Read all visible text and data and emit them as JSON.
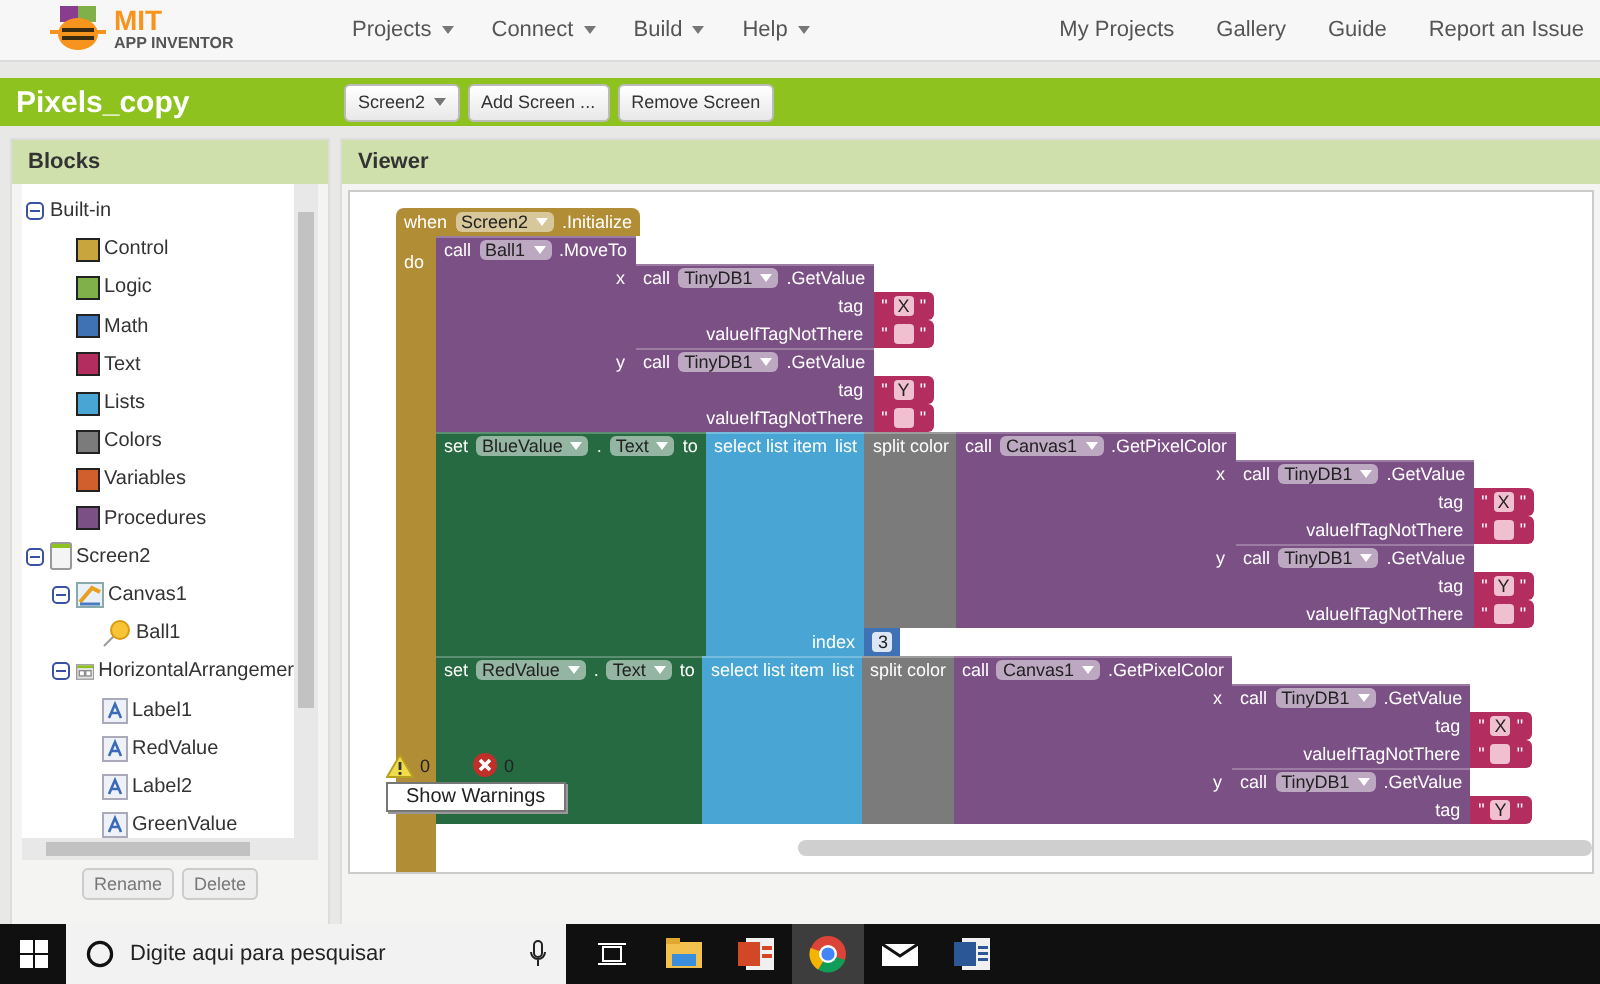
{
  "app": {
    "logo_mark": "MIT",
    "logo_name": "APP INVENTOR"
  },
  "menu": [
    {
      "label": "Projects"
    },
    {
      "label": "Connect"
    },
    {
      "label": "Build"
    },
    {
      "label": "Help"
    }
  ],
  "links": [
    "My Projects",
    "Gallery",
    "Guide",
    "Report an Issue"
  ],
  "project": {
    "title": "Pixels_copy",
    "screen": "Screen2",
    "buttons": [
      "Add Screen ...",
      "Remove Screen"
    ]
  },
  "blocks_panel": {
    "title": "Blocks",
    "tree": [
      {
        "label": "Built-in",
        "expanded": true,
        "children": [
          {
            "label": "Control",
            "color": "#c9a53d"
          },
          {
            "label": "Logic",
            "color": "#7fb04a"
          },
          {
            "label": "Math",
            "color": "#3f71b5"
          },
          {
            "label": "Text",
            "color": "#b32d5e"
          },
          {
            "label": "Lists",
            "color": "#49a6d4"
          },
          {
            "label": "Colors",
            "color": "#7b7b7b"
          },
          {
            "label": "Variables",
            "color": "#d05f2d"
          },
          {
            "label": "Procedures",
            "color": "#7b5185"
          }
        ]
      },
      {
        "label": "Screen2",
        "kind": "screen",
        "expanded": true,
        "children": [
          {
            "label": "Canvas1",
            "kind": "canvas",
            "expanded": true,
            "children": [
              {
                "label": "Ball1",
                "kind": "ball"
              }
            ]
          },
          {
            "label": "HorizontalArrangemer",
            "kind": "arrangement",
            "expanded": true,
            "children": [
              {
                "label": "Label1",
                "kind": "label"
              },
              {
                "label": "RedValue",
                "kind": "label"
              },
              {
                "label": "Label2",
                "kind": "label"
              },
              {
                "label": "GreenValue",
                "kind": "label"
              }
            ]
          }
        ]
      }
    ],
    "buttons": [
      "Rename",
      "Delete"
    ]
  },
  "viewer": {
    "title": "Viewer",
    "event": {
      "kind": "event",
      "parts": [
        {
          "kind": "label",
          "text": "when"
        },
        {
          "kind": "dropdown",
          "text": "Screen2"
        },
        {
          "kind": "label",
          "text": ".Initialize"
        }
      ],
      "do_label": "do",
      "statements": [
        {
          "kind": "method",
          "parts": [
            {
              "kind": "label",
              "text": "call"
            },
            {
              "kind": "dropdown",
              "text": "Ball1"
            },
            {
              "kind": "label",
              "text": ".MoveTo"
            }
          ],
          "inputs": [
            {
              "label": "x",
              "block": {
                "kind": "method",
                "parts": [
                  {
                    "kind": "label",
                    "text": "call"
                  },
                  {
                    "kind": "dropdown",
                    "text": "TinyDB1"
                  },
                  {
                    "kind": "label",
                    "text": ".GetValue"
                  }
                ],
                "inputs": [
                  {
                    "label": "tag",
                    "block": {
                      "kind": "text",
                      "parts": [
                        {
                          "kind": "label",
                          "text": "\""
                        },
                        {
                          "kind": "field",
                          "text": "X"
                        },
                        {
                          "kind": "label",
                          "text": "\""
                        }
                      ]
                    }
                  },
                  {
                    "label": "valueIfTagNotThere",
                    "block": {
                      "kind": "text",
                      "parts": [
                        {
                          "kind": "label",
                          "text": "\""
                        },
                        {
                          "kind": "field"
                        },
                        {
                          "kind": "label",
                          "text": "\""
                        }
                      ]
                    }
                  }
                ]
              }
            },
            {
              "label": "y",
              "block": {
                "kind": "method",
                "parts": [
                  {
                    "kind": "label",
                    "text": "call"
                  },
                  {
                    "kind": "dropdown",
                    "text": "TinyDB1"
                  },
                  {
                    "kind": "label",
                    "text": ".GetValue"
                  }
                ],
                "inputs": [
                  {
                    "label": "tag",
                    "block": {
                      "kind": "text",
                      "parts": [
                        {
                          "kind": "label",
                          "text": "\""
                        },
                        {
                          "kind": "field",
                          "text": "Y"
                        },
                        {
                          "kind": "label",
                          "text": "\""
                        }
                      ]
                    }
                  },
                  {
                    "label": "valueIfTagNotThere",
                    "block": {
                      "kind": "text",
                      "parts": [
                        {
                          "kind": "label",
                          "text": "\""
                        },
                        {
                          "kind": "field"
                        },
                        {
                          "kind": "label",
                          "text": "\""
                        }
                      ]
                    }
                  }
                ]
              }
            }
          ]
        },
        {
          "kind": "setter",
          "parts": [
            {
              "kind": "label",
              "text": "set"
            },
            {
              "kind": "dropdown",
              "text": "BlueValue"
            },
            {
              "kind": "label",
              "text": "."
            },
            {
              "kind": "dropdown",
              "text": "Text"
            },
            {
              "kind": "label",
              "text": "to"
            }
          ],
          "inputs": [
            {
              "block": {
                "kind": "list",
                "parts": [
                  {
                    "kind": "label",
                    "text": "select list item"
                  },
                  {
                    "kind": "label",
                    "text": "list"
                  }
                ],
                "inputs": [
                  {
                    "block": {
                      "kind": "color",
                      "parts": [
                        {
                          "kind": "label",
                          "text": "split color"
                        }
                      ],
                      "inputs": [
                        {
                          "block": {
                            "kind": "method",
                            "parts": [
                              {
                                "kind": "label",
                                "text": "call"
                              },
                              {
                                "kind": "dropdown",
                                "text": "Canvas1"
                              },
                              {
                                "kind": "label",
                                "text": ".GetPixelColor"
                              }
                            ],
                            "inputs": [
                              {
                                "label": "x",
                                "block": {
                                  "kind": "method",
                                  "parts": [
                                    {
                                      "kind": "label",
                                      "text": "call"
                                    },
                                    {
                                      "kind": "dropdown",
                                      "text": "TinyDB1"
                                    },
                                    {
                                      "kind": "label",
                                      "text": ".GetValue"
                                    }
                                  ],
                                  "inputs": [
                                    {
                                      "label": "tag",
                                      "block": {
                                        "kind": "text",
                                        "parts": [
                                          {
                                            "kind": "label",
                                            "text": "\""
                                          },
                                          {
                                            "kind": "field",
                                            "text": "X"
                                          },
                                          {
                                            "kind": "label",
                                            "text": "\""
                                          }
                                        ]
                                      }
                                    },
                                    {
                                      "label": "valueIfTagNotThere",
                                      "block": {
                                        "kind": "text",
                                        "parts": [
                                          {
                                            "kind": "label",
                                            "text": "\""
                                          },
                                          {
                                            "kind": "field"
                                          },
                                          {
                                            "kind": "label",
                                            "text": "\""
                                          }
                                        ]
                                      }
                                    }
                                  ]
                                }
                              },
                              {
                                "label": "y",
                                "block": {
                                  "kind": "method",
                                  "parts": [
                                    {
                                      "kind": "label",
                                      "text": "call"
                                    },
                                    {
                                      "kind": "dropdown",
                                      "text": "TinyDB1"
                                    },
                                    {
                                      "kind": "label",
                                      "text": ".GetValue"
                                    }
                                  ],
                                  "inputs": [
                                    {
                                      "label": "tag",
                                      "block": {
                                        "kind": "text",
                                        "parts": [
                                          {
                                            "kind": "label",
                                            "text": "\""
                                          },
                                          {
                                            "kind": "field",
                                            "text": "Y"
                                          },
                                          {
                                            "kind": "label",
                                            "text": "\""
                                          }
                                        ]
                                      }
                                    },
                                    {
                                      "label": "valueIfTagNotThere",
                                      "block": {
                                        "kind": "text",
                                        "parts": [
                                          {
                                            "kind": "label",
                                            "text": "\""
                                          },
                                          {
                                            "kind": "field"
                                          },
                                          {
                                            "kind": "label",
                                            "text": "\""
                                          }
                                        ]
                                      }
                                    }
                                  ]
                                }
                              }
                            ]
                          }
                        }
                      ]
                    }
                  },
                  {
                    "label": "index",
                    "block": {
                      "kind": "number",
                      "parts": [
                        {
                          "kind": "field",
                          "text": "3"
                        }
                      ]
                    }
                  }
                ]
              }
            }
          ]
        },
        {
          "kind": "setter",
          "parts": [
            {
              "kind": "label",
              "text": "set"
            },
            {
              "kind": "dropdown",
              "text": "RedValue"
            },
            {
              "kind": "label",
              "text": "."
            },
            {
              "kind": "dropdown",
              "text": "Text"
            },
            {
              "kind": "label",
              "text": "to"
            }
          ],
          "inputs": [
            {
              "block": {
                "kind": "list",
                "parts": [
                  {
                    "kind": "label",
                    "text": "select list item"
                  },
                  {
                    "kind": "label",
                    "text": "list"
                  }
                ],
                "inputs": [
                  {
                    "block": {
                      "kind": "color",
                      "parts": [
                        {
                          "kind": "label",
                          "text": "split color"
                        }
                      ],
                      "inputs": [
                        {
                          "block": {
                            "kind": "method",
                            "parts": [
                              {
                                "kind": "label",
                                "text": "call"
                              },
                              {
                                "kind": "dropdown",
                                "text": "Canvas1"
                              },
                              {
                                "kind": "label",
                                "text": ".GetPixelColor"
                              }
                            ],
                            "inputs": [
                              {
                                "label": "x",
                                "block": {
                                  "kind": "method",
                                  "parts": [
                                    {
                                      "kind": "label",
                                      "text": "call"
                                    },
                                    {
                                      "kind": "dropdown",
                                      "text": "TinyDB1"
                                    },
                                    {
                                      "kind": "label",
                                      "text": ".GetValue"
                                    }
                                  ],
                                  "inputs": [
                                    {
                                      "label": "tag",
                                      "block": {
                                        "kind": "text",
                                        "parts": [
                                          {
                                            "kind": "label",
                                            "text": "\""
                                          },
                                          {
                                            "kind": "field",
                                            "text": "X"
                                          },
                                          {
                                            "kind": "label",
                                            "text": "\""
                                          }
                                        ]
                                      }
                                    },
                                    {
                                      "label": "valueIfTagNotThere",
                                      "block": {
                                        "kind": "text",
                                        "parts": [
                                          {
                                            "kind": "label",
                                            "text": "\""
                                          },
                                          {
                                            "kind": "field"
                                          },
                                          {
                                            "kind": "label",
                                            "text": "\""
                                          }
                                        ]
                                      }
                                    }
                                  ]
                                }
                              },
                              {
                                "label": "y",
                                "block": {
                                  "kind": "method",
                                  "parts": [
                                    {
                                      "kind": "label",
                                      "text": "call"
                                    },
                                    {
                                      "kind": "dropdown",
                                      "text": "TinyDB1"
                                    },
                                    {
                                      "kind": "label",
                                      "text": ".GetValue"
                                    }
                                  ],
                                  "inputs": [
                                    {
                                      "label": "tag",
                                      "block": {
                                        "kind": "text",
                                        "parts": [
                                          {
                                            "kind": "label",
                                            "text": "\""
                                          },
                                          {
                                            "kind": "field",
                                            "text": "Y"
                                          },
                                          {
                                            "kind": "label",
                                            "text": "\""
                                          }
                                        ]
                                      }
                                    }
                                  ]
                                }
                              }
                            ]
                          }
                        }
                      ]
                    }
                  }
                ]
              }
            }
          ]
        }
      ]
    },
    "warnings": {
      "warning_count": "0",
      "error_count": "0",
      "button": "Show Warnings"
    }
  },
  "taskbar": {
    "search_placeholder": "Digite aqui para pesquisar",
    "apps": [
      {
        "kind": "files",
        "selected": false
      },
      {
        "kind": "slides",
        "selected": false
      },
      {
        "kind": "browser",
        "selected": true
      },
      {
        "kind": "mail",
        "selected": false
      },
      {
        "kind": "document",
        "selected": false
      }
    ]
  }
}
